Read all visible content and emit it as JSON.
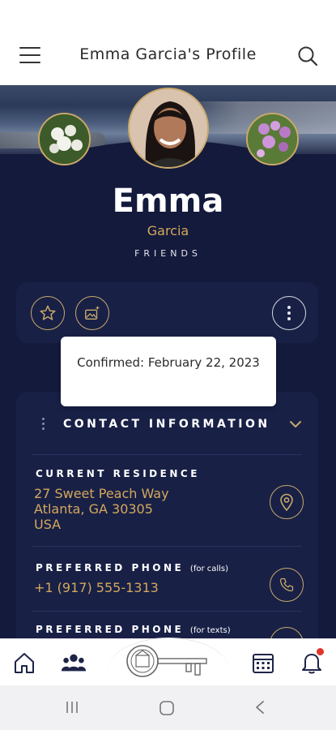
{
  "header": {
    "title": "Emma Garcia's Profile",
    "menu_icon": "hamburger-menu-icon",
    "search_icon": "search-icon"
  },
  "profile": {
    "first_name": "Emma",
    "last_name": "Garcia",
    "relationship": "FRIENDS",
    "avatar_main": "portrait-avatar",
    "avatar_left": "white-hydrangea-photo",
    "avatar_right": "purple-flowers-photo"
  },
  "actions": {
    "favorite_icon": "star-icon",
    "gallery_icon": "photo-sparkle-icon",
    "more_icon": "vertical-dots-icon"
  },
  "tooltip": {
    "text": "Confirmed: February 22, 2023"
  },
  "contact": {
    "section_title": "CONTACT INFORMATION",
    "residence_label": "CURRENT RESIDENCE",
    "residence_line1": "27 Sweet Peach Way",
    "residence_line2": "Atlanta, GA 30305",
    "residence_line3": "USA",
    "phone_calls_label": "PREFERRED PHONE",
    "phone_calls_note": "(for calls)",
    "phone_calls_value": "+1 (917) 555-1313",
    "phone_texts_label": "PREFERRED PHONE",
    "phone_texts_note": "(for texts)"
  },
  "nav": {
    "home_icon": "home-icon",
    "people_icon": "people-icon",
    "center_icon": "key-logo-icon",
    "calendar_icon": "calendar-icon",
    "bell_icon": "bell-icon"
  },
  "colors": {
    "navy": "#141a3c",
    "card": "#182046",
    "gold": "#d4a85c",
    "notification": "#e0342b"
  }
}
